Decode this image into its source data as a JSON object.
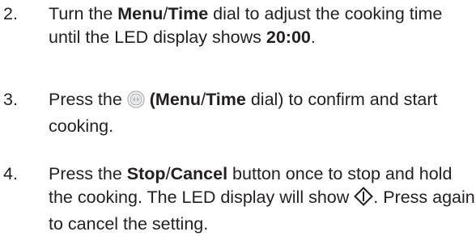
{
  "steps": [
    {
      "number": "2.",
      "parts": {
        "t1": "Turn the ",
        "b1": "Menu",
        "t2": "/",
        "b2": "Time",
        "t3": " dial to adjust the cooking time until the LED display shows ",
        "b3": "20:00",
        "t4": "."
      }
    },
    {
      "number": "3.",
      "icon": "dial-button-icon",
      "parts": {
        "t1": "Press the ",
        "b1": " (Menu",
        "t2": "/",
        "b2": "Time",
        "t3": " dial) to confirm and start cooking."
      }
    },
    {
      "number": "4.",
      "icon": "start-symbol-icon",
      "parts": {
        "t1": "Press the ",
        "b1": "Stop",
        "t2": "/",
        "b2": "Cancel",
        "t3": " button once to stop and hold the cooking. The LED display will show ",
        "t4": ". Press again to cancel the setting."
      }
    }
  ]
}
